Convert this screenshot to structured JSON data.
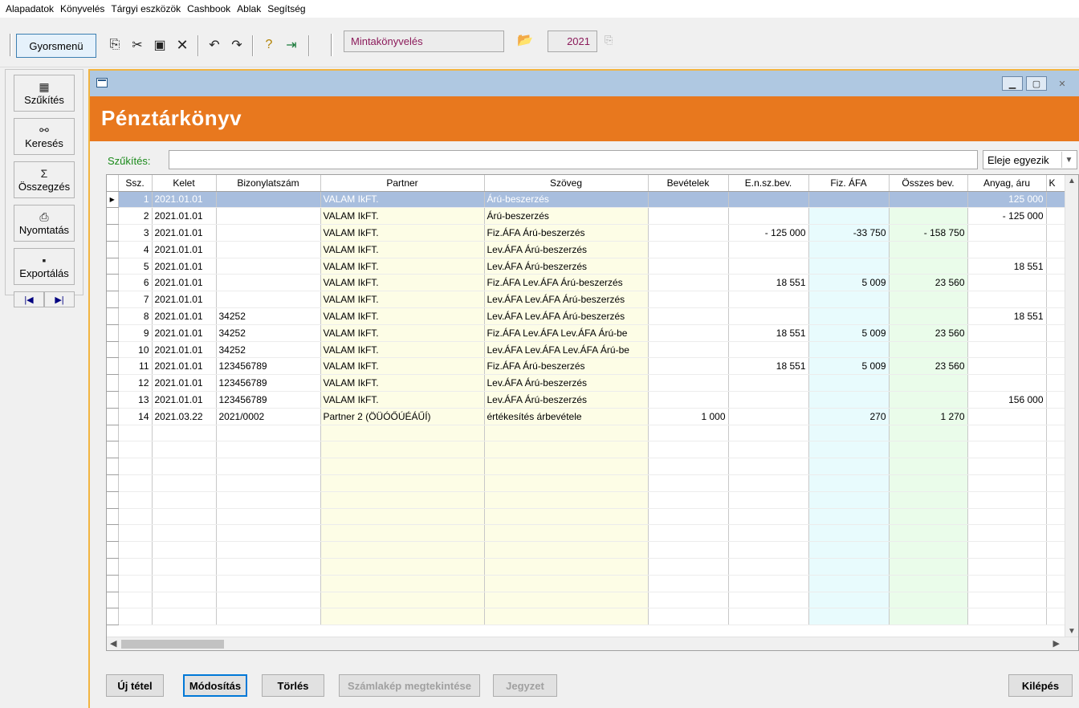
{
  "menu": [
    "Alapadatok",
    "Könyvelés",
    "Tárgyi eszközök",
    "Cashbook",
    "Ablak",
    "Segítség"
  ],
  "toolbar": {
    "quick_menu": "Gyorsmenü",
    "company": "Mintakönyvelés",
    "year": "2021"
  },
  "side": {
    "filter": "Szűkítés",
    "search": "Keresés",
    "sum": "Összegzés",
    "print": "Nyomtatás",
    "export": "Exportálás"
  },
  "window": {
    "title": "Pénztárkönyv"
  },
  "filter": {
    "label": "Szűkítés:",
    "value": "",
    "mode": "Eleje egyezik"
  },
  "columns": [
    "Ssz.",
    "Kelet",
    "Bizonylatszám",
    "Partner",
    "Szöveg",
    "Bevételek",
    "E.n.sz.bev.",
    "Fiz. ÁFA",
    "Összes bev.",
    "Anyag, áru",
    "K"
  ],
  "rows": [
    {
      "ssz": "1",
      "kelet": "2021.01.01",
      "biz": "",
      "partner": "VALAM IkFT.",
      "szoveg": "Árú-beszerzés",
      "bev": "",
      "ensz": "",
      "fiz": "",
      "ossz": "",
      "anyag": "125 000"
    },
    {
      "ssz": "2",
      "kelet": "2021.01.01",
      "biz": "",
      "partner": "VALAM IkFT.",
      "szoveg": "Árú-beszerzés",
      "bev": "",
      "ensz": "",
      "fiz": "",
      "ossz": "",
      "anyag": "- 125 000"
    },
    {
      "ssz": "3",
      "kelet": "2021.01.01",
      "biz": "",
      "partner": "VALAM IkFT.",
      "szoveg": "Fiz.ÁFA Árú-beszerzés",
      "bev": "",
      "ensz": "- 125 000",
      "fiz": "-33 750",
      "ossz": "- 158 750",
      "anyag": ""
    },
    {
      "ssz": "4",
      "kelet": "2021.01.01",
      "biz": "",
      "partner": "VALAM IkFT.",
      "szoveg": "Lev.ÁFA Árú-beszerzés",
      "bev": "",
      "ensz": "",
      "fiz": "",
      "ossz": "",
      "anyag": ""
    },
    {
      "ssz": "5",
      "kelet": "2021.01.01",
      "biz": "",
      "partner": "VALAM IkFT.",
      "szoveg": "Lev.ÁFA Árú-beszerzés",
      "bev": "",
      "ensz": "",
      "fiz": "",
      "ossz": "",
      "anyag": "18 551"
    },
    {
      "ssz": "6",
      "kelet": "2021.01.01",
      "biz": "",
      "partner": "VALAM IkFT.",
      "szoveg": "Fiz.ÁFA Lev.ÁFA Árú-beszerzés",
      "bev": "",
      "ensz": "18 551",
      "fiz": "5 009",
      "ossz": "23 560",
      "anyag": ""
    },
    {
      "ssz": "7",
      "kelet": "2021.01.01",
      "biz": "",
      "partner": "VALAM IkFT.",
      "szoveg": "Lev.ÁFA Lev.ÁFA Árú-beszerzés",
      "bev": "",
      "ensz": "",
      "fiz": "",
      "ossz": "",
      "anyag": ""
    },
    {
      "ssz": "8",
      "kelet": "2021.01.01",
      "biz": "34252",
      "partner": "VALAM IkFT.",
      "szoveg": "Lev.ÁFA Lev.ÁFA Árú-beszerzés",
      "bev": "",
      "ensz": "",
      "fiz": "",
      "ossz": "",
      "anyag": "18 551"
    },
    {
      "ssz": "9",
      "kelet": "2021.01.01",
      "biz": "34252",
      "partner": "VALAM IkFT.",
      "szoveg": "Fiz.ÁFA Lev.ÁFA Lev.ÁFA Árú-be",
      "bev": "",
      "ensz": "18 551",
      "fiz": "5 009",
      "ossz": "23 560",
      "anyag": ""
    },
    {
      "ssz": "10",
      "kelet": "2021.01.01",
      "biz": "34252",
      "partner": "VALAM IkFT.",
      "szoveg": "Lev.ÁFA Lev.ÁFA Lev.ÁFA Árú-be",
      "bev": "",
      "ensz": "",
      "fiz": "",
      "ossz": "",
      "anyag": ""
    },
    {
      "ssz": "11",
      "kelet": "2021.01.01",
      "biz": "123456789",
      "partner": "VALAM IkFT.",
      "szoveg": "Fiz.ÁFA Árú-beszerzés",
      "bev": "",
      "ensz": "18 551",
      "fiz": "5 009",
      "ossz": "23 560",
      "anyag": ""
    },
    {
      "ssz": "12",
      "kelet": "2021.01.01",
      "biz": "123456789",
      "partner": "VALAM IkFT.",
      "szoveg": "Lev.ÁFA Árú-beszerzés",
      "bev": "",
      "ensz": "",
      "fiz": "",
      "ossz": "",
      "anyag": ""
    },
    {
      "ssz": "13",
      "kelet": "2021.01.01",
      "biz": "123456789",
      "partner": "VALAM IkFT.",
      "szoveg": "Lev.ÁFA Árú-beszerzés",
      "bev": "",
      "ensz": "",
      "fiz": "",
      "ossz": "",
      "anyag": "156 000"
    },
    {
      "ssz": "14",
      "kelet": "2021.03.22",
      "biz": "2021/0002",
      "partner": "Partner 2 (ÖÜÓŐÚÉÁŰÍ)",
      "szoveg": "értékesítés árbevétele",
      "bev": "1 000",
      "ensz": "",
      "fiz": "270",
      "ossz": "1 270",
      "anyag": ""
    }
  ],
  "buttons": {
    "new": "Új tétel",
    "modify": "Módosítás",
    "delete": "Törlés",
    "invoice_view": "Számlakép megtekintése",
    "note": "Jegyzet",
    "exit": "Kilépés"
  }
}
